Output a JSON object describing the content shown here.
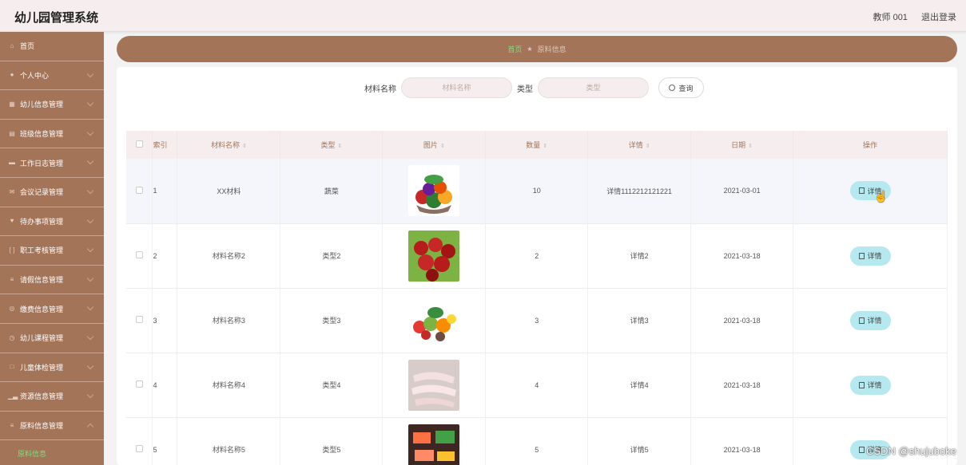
{
  "header": {
    "app_title": "幼儿园管理系统",
    "user": "教师 001",
    "logout": "退出登录"
  },
  "sidebar": {
    "items": [
      {
        "label": "首页",
        "icon": "home-icon"
      },
      {
        "label": "个人中心",
        "icon": "user-icon"
      },
      {
        "label": "幼儿信息管理",
        "icon": "grid-icon"
      },
      {
        "label": "班级信息管理",
        "icon": "class-icon"
      },
      {
        "label": "工作日志管理",
        "icon": "log-icon"
      },
      {
        "label": "会议记录管理",
        "icon": "meeting-icon"
      },
      {
        "label": "待办事项管理",
        "icon": "todo-icon"
      },
      {
        "label": "职工考核管理",
        "icon": "assessment-icon"
      },
      {
        "label": "请假信息管理",
        "icon": "list-icon"
      },
      {
        "label": "缴费信息管理",
        "icon": "payment-icon"
      },
      {
        "label": "幼儿课程管理",
        "icon": "course-icon"
      },
      {
        "label": "儿童体检管理",
        "icon": "health-icon"
      },
      {
        "label": "资源信息管理",
        "icon": "chart-icon"
      },
      {
        "label": "原料信息管理",
        "icon": "list-icon"
      }
    ],
    "active_sub": "原料信息"
  },
  "breadcrumb": {
    "home": "首页",
    "current": "原料信息"
  },
  "search": {
    "name_label": "材料名称",
    "name_placeholder": "材料名称",
    "type_label": "类型",
    "type_placeholder": "类型",
    "button": "查询"
  },
  "table": {
    "headers": [
      "索引",
      "材料名称",
      "类型",
      "图片",
      "数量",
      "详情",
      "日期",
      "操作"
    ],
    "rows": [
      {
        "index": "1",
        "name": "XX材料",
        "type": "蔬菜",
        "qty": "10",
        "detail": "详情1112212121221",
        "date": "2021-03-01",
        "action": "详情"
      },
      {
        "index": "2",
        "name": "材料名称2",
        "type": "类型2",
        "qty": "2",
        "detail": "详情2",
        "date": "2021-03-18",
        "action": "详情"
      },
      {
        "index": "3",
        "name": "材料名称3",
        "type": "类型3",
        "qty": "3",
        "detail": "详情3",
        "date": "2021-03-18",
        "action": "详情"
      },
      {
        "index": "4",
        "name": "材料名称4",
        "type": "类型4",
        "qty": "4",
        "detail": "详情4",
        "date": "2021-03-18",
        "action": "详情"
      },
      {
        "index": "5",
        "name": "材料名称5",
        "type": "类型5",
        "qty": "5",
        "detail": "详情5",
        "date": "2021-03-18",
        "action": "详情"
      }
    ]
  },
  "watermark": "CSDN @shujuboke",
  "colors": {
    "sidebar": "#a37458",
    "accent_green": "#7ddf7d",
    "detail_button": "#b6e8ef",
    "header_bg": "#f6eeee"
  }
}
